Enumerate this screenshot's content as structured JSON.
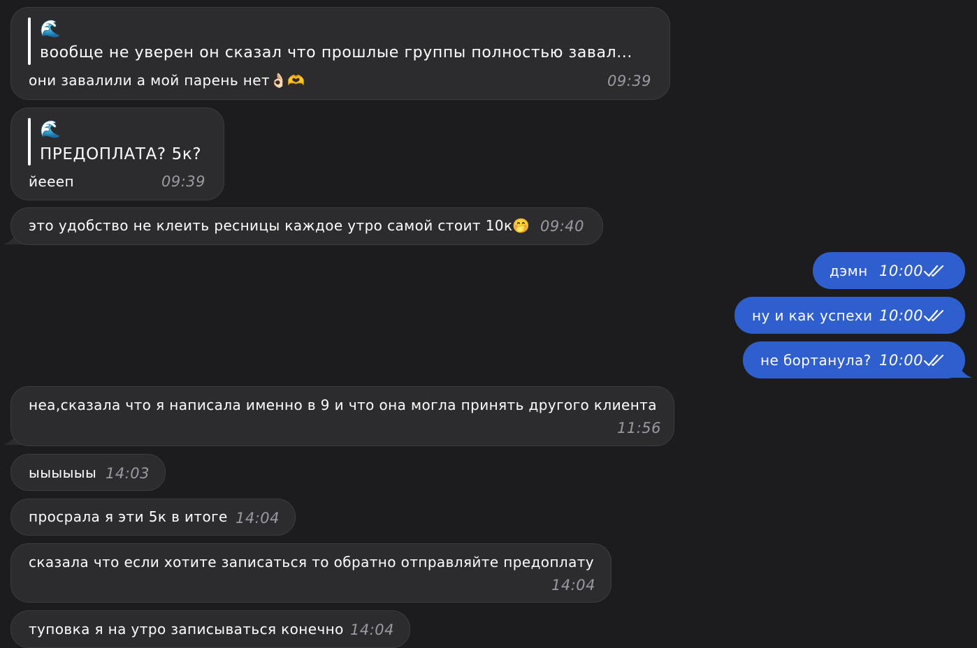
{
  "messages": [
    {
      "quote": {
        "icon": "🌊",
        "text": "вообще не уверен он сказал что прошлые группы полностью завал..."
      },
      "text": "они завалили а мой парень нет",
      "emoji": "👌🏻🫶",
      "time": "09:39"
    },
    {
      "quote": {
        "icon": "🌊",
        "text": "ПРЕДОПЛАТА? 5к?"
      },
      "text": "йееeп",
      "time": "09:39"
    },
    {
      "text": "это удобство не клеить ресницы каждое утро самой стоит 10к",
      "emoji": "🤭",
      "time": "09:40"
    },
    {
      "text": "дэмн",
      "time": "10:00"
    },
    {
      "text": "ну и как успехи",
      "time": "10:00"
    },
    {
      "text": "не бортанула?",
      "time": "10:00"
    },
    {
      "text": "неа,сказала что я написала именно в 9 и что она могла принять другого клиента",
      "time": "11:56"
    },
    {
      "text": "ыыыыыы",
      "time": "14:03"
    },
    {
      "text": "просрала я эти 5к в итоге",
      "time": "14:04"
    },
    {
      "text": "сказала что если хотите записаться то обратно отправляйте предоплату",
      "time": "14:04"
    },
    {
      "text": "туповка я на утро записываться конечно",
      "time": "14:04"
    }
  ],
  "colors": {
    "background": "#1c1c1e",
    "incoming_bubble": "#2c2c2e",
    "outgoing_bubble": "#2f5fcf",
    "timestamp_incoming": "#9a9aa0",
    "text": "#ffffff"
  },
  "icons": {
    "read_receipt": "double-check-icon",
    "quote": "wave-icon"
  }
}
